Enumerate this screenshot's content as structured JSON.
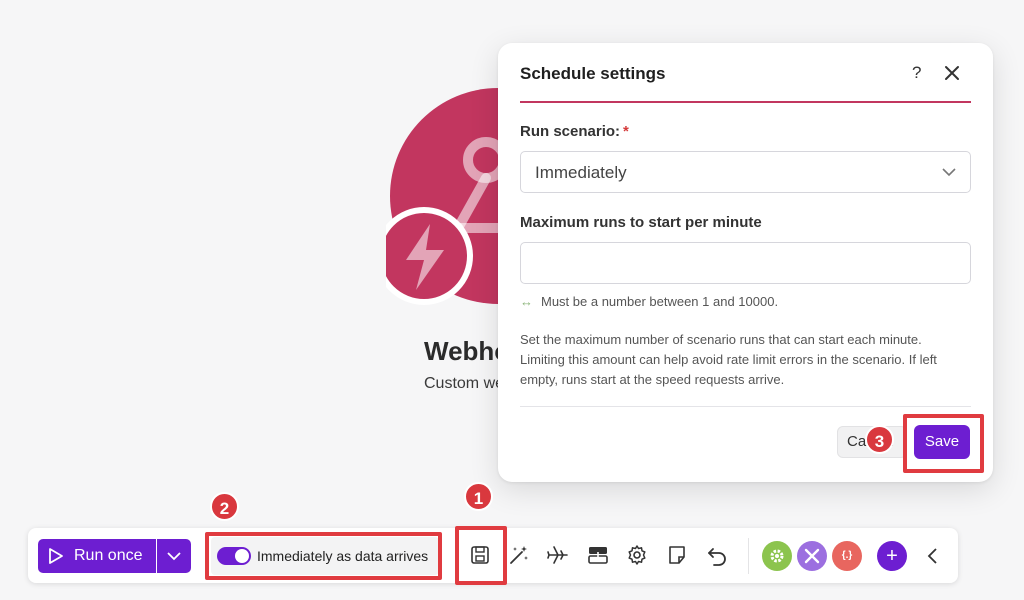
{
  "module": {
    "title": "Webhooks",
    "subtitle": "Custom webhook",
    "color": "#c2365f"
  },
  "dialog": {
    "title": "Schedule settings",
    "help_label": "?",
    "run_scenario_label": "Run scenario:",
    "required_mark": "*",
    "run_scenario_value": "Immediately",
    "max_runs_label": "Maximum runs to start per minute",
    "max_runs_value": "",
    "hint": "Must be a number between 1 and 10000.",
    "description": "Set the maximum number of scenario runs that can start each minute. Limiting this amount can help avoid rate limit errors in the scenario. If left empty, runs start at the speed requests arrive.",
    "cancel_label": "Cancel",
    "save_label": "Save"
  },
  "markers": [
    "1",
    "2",
    "3"
  ],
  "toolbar": {
    "run_once_label": "Run once",
    "schedule_label": "Immediately as data arrives",
    "schedule_enabled": true,
    "tools": [
      "save-icon",
      "magic-wand-icon",
      "airplane-icon",
      "flow-control-icon",
      "settings-icon",
      "notes-icon",
      "undo-icon"
    ],
    "apps": [
      {
        "name": "tools-app-icon",
        "color": "#8cc44e"
      },
      {
        "name": "flow-app-icon",
        "color": "#9c6fe0"
      },
      {
        "name": "text-parser-app-icon",
        "color": "#e8665f",
        "text": "{.}"
      }
    ],
    "add_label": "+"
  },
  "colors": {
    "accent": "#6d1ed1",
    "highlight": "#e03b40",
    "brand": "#c2365f"
  }
}
